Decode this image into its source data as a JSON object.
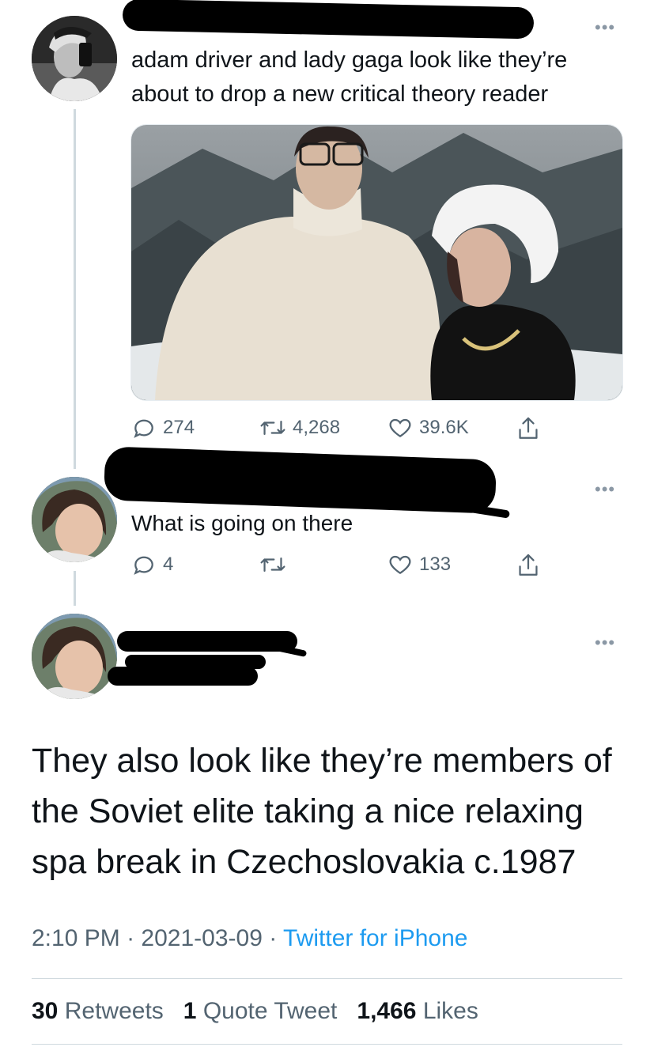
{
  "tweet1": {
    "text": "adam driver and lady gaga look like they’re about to drop a new critical theory reader",
    "actions": {
      "replies": "274",
      "retweets": "4,268",
      "likes": "39.6K"
    }
  },
  "tweet2": {
    "text": "What is going on there",
    "actions": {
      "replies": "4",
      "retweets": "",
      "likes": "133"
    }
  },
  "main_tweet": {
    "text": "They also look like they’re members of the Soviet elite taking a nice relaxing spa break in Czechoslovakia c.1987",
    "time": "2:10 PM",
    "separator": "·",
    "date": "2021-03-09",
    "source": "Twitter for iPhone",
    "stats": {
      "retweets_count": "30",
      "retweets_label": "Retweets",
      "quotes_count": "1",
      "quotes_label": "Quote Tweet",
      "likes_count": "1,466",
      "likes_label": "Likes"
    }
  },
  "icons": {
    "more": "more-horizontal-icon",
    "reply": "reply-icon",
    "retweet": "retweet-icon",
    "like": "heart-icon",
    "share": "share-icon"
  },
  "colors": {
    "accent": "#1d9bf0",
    "secondary_text": "#536471",
    "redaction": "#000000"
  }
}
